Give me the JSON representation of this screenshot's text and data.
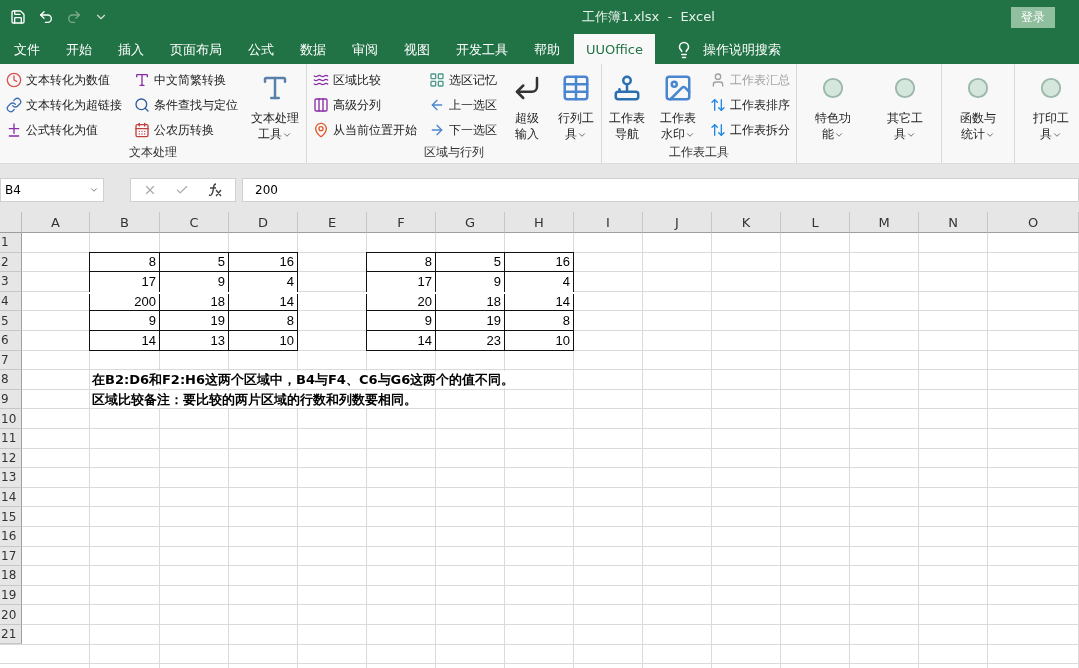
{
  "window": {
    "title": "工作簿1.xlsx  -  Excel",
    "sign_in": "登录"
  },
  "tabs": [
    {
      "label": "文件",
      "selected": false
    },
    {
      "label": "开始",
      "selected": false
    },
    {
      "label": "插入",
      "selected": false
    },
    {
      "label": "页面布局",
      "selected": false
    },
    {
      "label": "公式",
      "selected": false
    },
    {
      "label": "数据",
      "selected": false
    },
    {
      "label": "审阅",
      "selected": false
    },
    {
      "label": "视图",
      "selected": false
    },
    {
      "label": "开发工具",
      "selected": false
    },
    {
      "label": "帮助",
      "selected": false
    },
    {
      "label": "UUOffice",
      "selected": true
    }
  ],
  "tell_me": "操作说明搜索",
  "ribbon": [
    {
      "label": "文本处理",
      "columns": [
        {
          "kind": "stack",
          "items": [
            {
              "label": "文本转化为数值",
              "disabled": false
            },
            {
              "label": "文本转化为超链接",
              "disabled": false
            },
            {
              "label": "公式转化为值",
              "disabled": false
            }
          ]
        },
        {
          "kind": "stack",
          "items": [
            {
              "label": "中文简繁转换",
              "disabled": false
            },
            {
              "label": "条件查找与定位",
              "disabled": false
            },
            {
              "label": "公农历转换",
              "disabled": false
            }
          ]
        },
        {
          "kind": "large",
          "label": "文本处理工具",
          "dropdown": true
        }
      ]
    },
    {
      "label": "区域与行列",
      "columns": [
        {
          "kind": "stack",
          "items": [
            {
              "label": "区域比较",
              "disabled": false
            },
            {
              "label": "高级分列",
              "disabled": false
            },
            {
              "label": "从当前位置开始",
              "disabled": false
            }
          ]
        },
        {
          "kind": "stack",
          "items": [
            {
              "label": "选区记忆",
              "disabled": false
            },
            {
              "label": "上一选区",
              "disabled": false
            },
            {
              "label": "下一选区",
              "disabled": false
            }
          ]
        },
        {
          "kind": "large",
          "label": "超级输入",
          "dropdown": false
        },
        {
          "kind": "large",
          "label": "行列工具",
          "dropdown": true
        }
      ]
    },
    {
      "label": "工作表工具",
      "columns": [
        {
          "kind": "large",
          "label": "工作表导航",
          "dropdown": false
        },
        {
          "kind": "large",
          "label": "工作表水印",
          "dropdown": true
        },
        {
          "kind": "stack",
          "items": [
            {
              "label": "工作表汇总",
              "disabled": true
            },
            {
              "label": "工作表排序",
              "disabled": false
            },
            {
              "label": "工作表拆分",
              "disabled": false
            }
          ]
        }
      ]
    },
    {
      "columns": [
        {
          "kind": "plain",
          "label": "特色功能",
          "dropdown": true
        },
        {
          "kind": "plain",
          "label": "其它工具",
          "dropdown": true
        }
      ]
    },
    {
      "columns": [
        {
          "kind": "plain",
          "label": "函数与统计",
          "dropdown": true
        }
      ]
    },
    {
      "columns": [
        {
          "kind": "plain",
          "label": "打印工具",
          "dropdown": true
        }
      ]
    }
  ],
  "formula_bar": {
    "name_box": "B4",
    "value": "200"
  },
  "sheet": {
    "columns": [
      "A",
      "B",
      "C",
      "D",
      "E",
      "F",
      "G",
      "H",
      "I",
      "J",
      "K",
      "L",
      "M",
      "N",
      "O"
    ],
    "row_labels": [
      "1",
      "2",
      "3",
      "4",
      "5",
      "6",
      "7",
      "8",
      "9",
      "10",
      "11",
      "12",
      "13",
      "14",
      "15",
      "16",
      "17",
      "18",
      "19",
      "20",
      "21"
    ],
    "blocks": [
      {
        "rows": [
          {
            "values": [
              "8",
              "5",
              "16"
            ],
            "joined_below": false
          },
          {
            "values": [
              "17",
              "9",
              "4"
            ],
            "joined_below": true
          },
          {
            "values": [
              "200",
              "18",
              "14"
            ],
            "joined_below": false
          },
          {
            "values": [
              "9",
              "19",
              "8"
            ],
            "joined_below": false
          },
          {
            "values": [
              "14",
              "13",
              "10"
            ],
            "joined_below": false
          }
        ]
      },
      {
        "rows": [
          {
            "values": [
              "8",
              "5",
              "16"
            ],
            "joined_below": false
          },
          {
            "values": [
              "17",
              "9",
              "4"
            ],
            "joined_below": true
          },
          {
            "values": [
              "20",
              "18",
              "14"
            ],
            "joined_below": false
          },
          {
            "values": [
              "9",
              "19",
              "8"
            ],
            "joined_below": false
          },
          {
            "values": [
              "14",
              "23",
              "10"
            ],
            "joined_below": false
          }
        ]
      }
    ],
    "notes": [
      "在B2:D6和F2:H6这两个区域中，B4与F4、C6与G6这两个的值不同。",
      "区域比较备注：要比较的两片区域的行数和列数要相同。"
    ]
  }
}
